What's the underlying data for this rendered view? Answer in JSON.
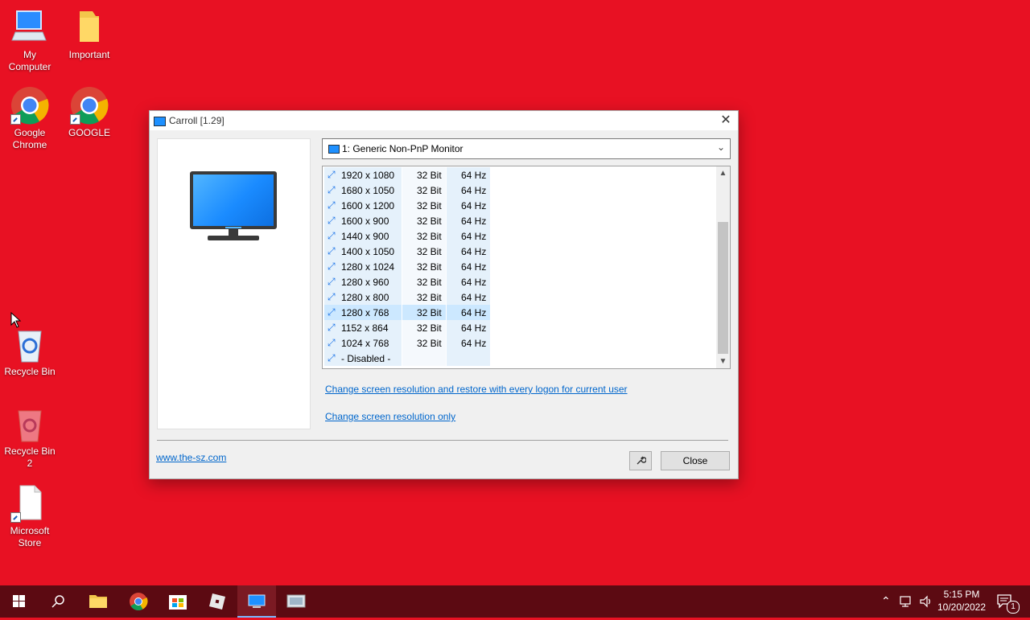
{
  "desktop": {
    "icons": [
      {
        "label": "My Computer",
        "icon": "computer-icon"
      },
      {
        "label": "Important",
        "icon": "folder-icon"
      },
      {
        "label": "Google Chrome",
        "icon": "chrome-icon"
      },
      {
        "label": "GOOGLE",
        "icon": "chrome-icon"
      },
      {
        "label": "Recycle Bin",
        "icon": "recycle-bin-icon"
      },
      {
        "label": "Recycle Bin 2",
        "icon": "recycle-bin-icon"
      },
      {
        "label": "Microsoft Store",
        "icon": "file-icon"
      }
    ]
  },
  "window": {
    "title": "Carroll [1.29]",
    "close_glyph": "✕",
    "monitor_select": "1: Generic Non-PnP Monitor",
    "modes": [
      {
        "res": "1920 x 1080",
        "bits": "32 Bit",
        "hz": "64 Hz"
      },
      {
        "res": "1680 x 1050",
        "bits": "32 Bit",
        "hz": "64 Hz"
      },
      {
        "res": "1600 x 1200",
        "bits": "32 Bit",
        "hz": "64 Hz"
      },
      {
        "res": "1600 x 900",
        "bits": "32 Bit",
        "hz": "64 Hz"
      },
      {
        "res": "1440 x 900",
        "bits": "32 Bit",
        "hz": "64 Hz"
      },
      {
        "res": "1400 x 1050",
        "bits": "32 Bit",
        "hz": "64 Hz"
      },
      {
        "res": "1280 x 1024",
        "bits": "32 Bit",
        "hz": "64 Hz"
      },
      {
        "res": "1280 x 960",
        "bits": "32 Bit",
        "hz": "64 Hz"
      },
      {
        "res": "1280 x 800",
        "bits": "32 Bit",
        "hz": "64 Hz"
      },
      {
        "res": "1280 x 768",
        "bits": "32 Bit",
        "hz": "64 Hz"
      },
      {
        "res": "1152 x 864",
        "bits": "32 Bit",
        "hz": "64 Hz"
      },
      {
        "res": "1024 x 768",
        "bits": "32 Bit",
        "hz": "64 Hz"
      },
      {
        "res": "- Disabled -",
        "bits": "",
        "hz": ""
      }
    ],
    "selected_mode": "1280 x 768",
    "link_restore": "Change screen resolution and restore with every logon for current user",
    "link_only": "Change screen resolution only",
    "website": "www.the-sz.com",
    "close_button": "Close"
  },
  "taskbar": {
    "time": "5:15 PM",
    "date": "10/20/2022",
    "notification_count": "1"
  },
  "colors": {
    "desktop_bg": "#e81123",
    "taskbar_bg": "#5c0a12",
    "link": "#0066cc",
    "selected_row": "#cce8ff"
  }
}
